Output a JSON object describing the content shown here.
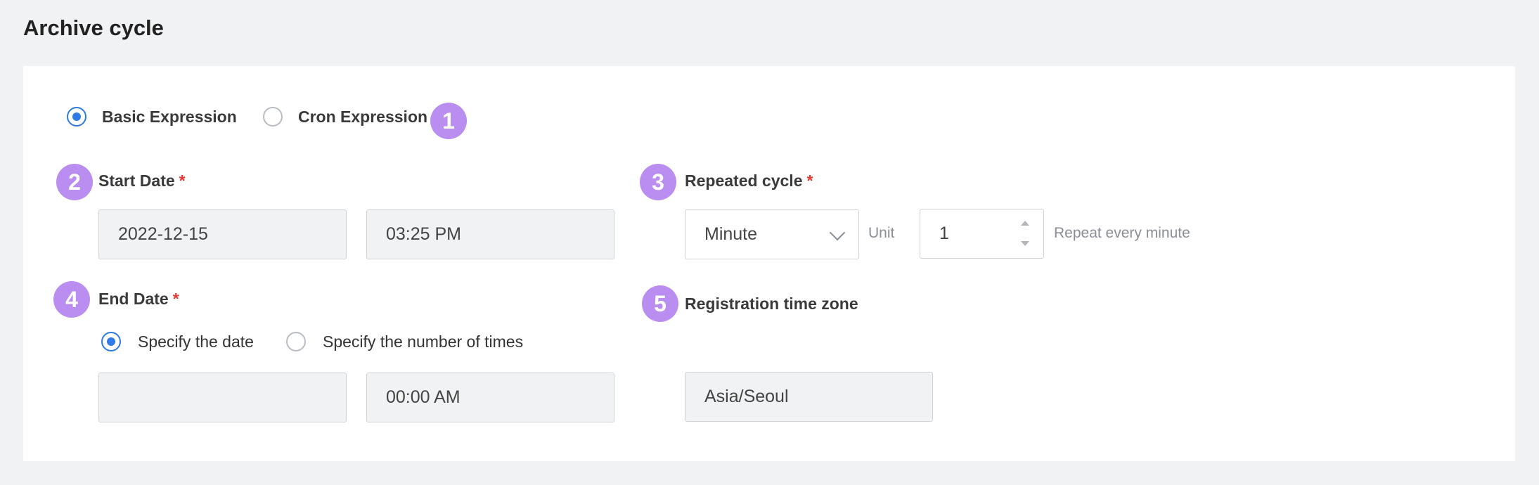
{
  "page": {
    "title": "Archive cycle"
  },
  "schedule_type": {
    "options": [
      {
        "label": "Basic Expression",
        "selected": true
      },
      {
        "label": "Cron Expression",
        "selected": false
      }
    ]
  },
  "badges": [
    "1",
    "2",
    "3",
    "4",
    "5"
  ],
  "start_date": {
    "label": "Start Date",
    "required_mark": "*",
    "date_value": "2022-12-15",
    "time_value": "03:25 PM"
  },
  "repeated_cycle": {
    "label": "Repeated cycle",
    "required_mark": "*",
    "unit_selected": "Minute",
    "unit_label": "Unit",
    "count_value": "1",
    "hint": "Repeat every minute"
  },
  "end_date": {
    "label": "End Date",
    "required_mark": "*",
    "options": [
      {
        "label": "Specify the date",
        "selected": true
      },
      {
        "label": "Specify the number of times",
        "selected": false
      }
    ],
    "date_value": "",
    "time_value": "00:00 AM"
  },
  "time_zone": {
    "label": "Registration time zone",
    "value": "Asia/Seoul"
  },
  "colors": {
    "accent": "#2f7ae5",
    "badge": "#b98ef0",
    "required": "#e53935",
    "background": "#f1f2f4"
  }
}
